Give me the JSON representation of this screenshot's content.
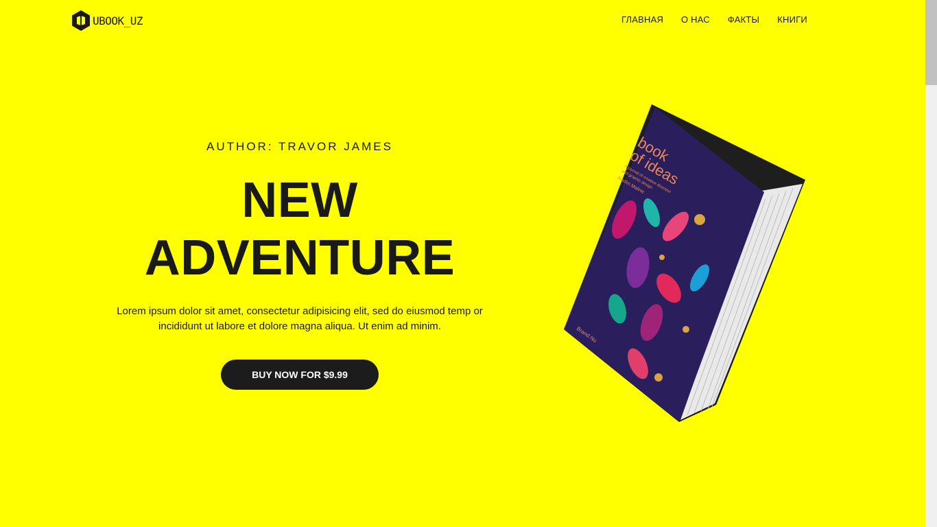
{
  "header": {
    "logo_text": "UBOOK_UZ",
    "logo_icon": "book-cube-icon",
    "nav": [
      "ГЛАВНАЯ",
      "О НАС",
      "ФАКТЫ",
      "КНИГИ"
    ]
  },
  "hero": {
    "author": "AUTHOR: TRAVOR JAMES",
    "title_line1": "NEW",
    "title_line2": "ADVENTURE",
    "description": "Lorem ipsum dolor sit amet, consectetur adipisicing elit, sed do eiusmod temp or incididunt ut labore et dolore magna aliqua. Ut enim ad minim.",
    "button_label": "BUY NOW FOR $9.99"
  },
  "book": {
    "title_line1": "book",
    "title_line2": "of ideas",
    "subtitle_line1": "A journal of creative direction",
    "subtitle_line2": "and graphic design",
    "author_name": "Radim Malinic",
    "spine_label": "Brand Nu"
  },
  "colors": {
    "background": "#ffff00",
    "text": "#1a1a1a",
    "button": "#1c1c1c",
    "book_cover": "#2a1f5c"
  }
}
